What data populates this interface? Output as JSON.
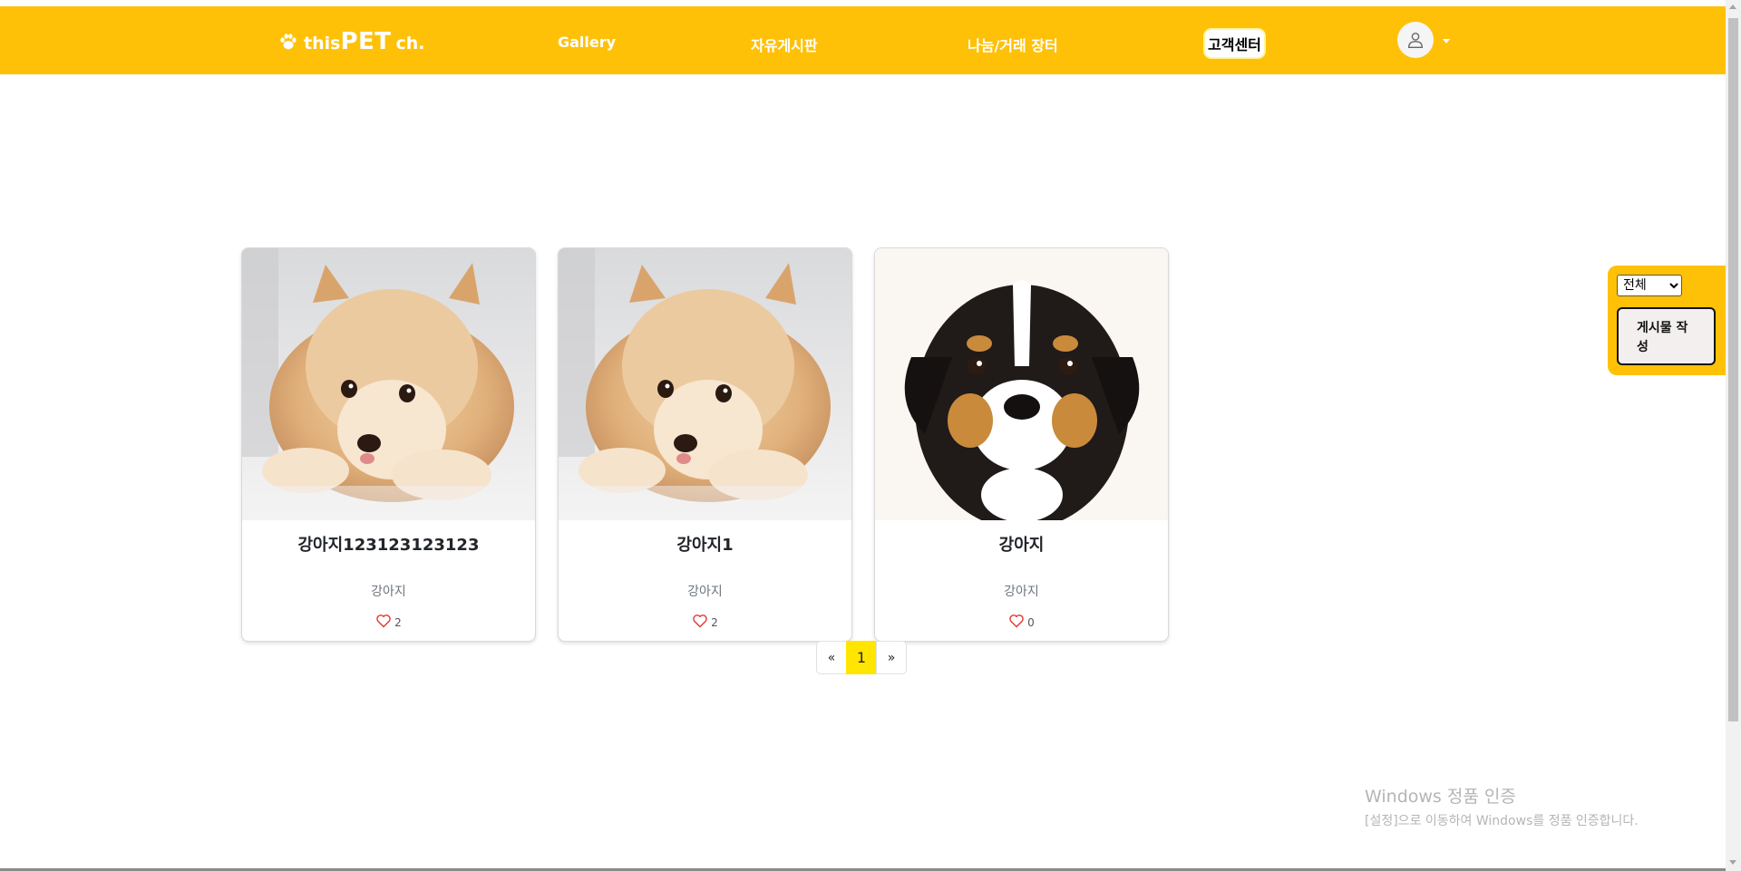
{
  "header": {
    "logo": {
      "this": "this",
      "pet": "PET",
      "ch": "ch."
    },
    "nav": [
      "Gallery",
      "자유게시판",
      "나눔/거래 장터",
      "고객센터"
    ]
  },
  "cards": [
    {
      "title": "강아지123123123123",
      "category": "강아지",
      "likes": "2",
      "image": "pomeranian-puppy"
    },
    {
      "title": "강아지1",
      "category": "강아지",
      "likes": "2",
      "image": "pomeranian-puppy"
    },
    {
      "title": "강아지",
      "category": "강아지",
      "likes": "0",
      "image": "tricolor-puppy"
    }
  ],
  "pagination": {
    "prev": "«",
    "current": "1",
    "next": "»"
  },
  "sidebar": {
    "filter_selected": "전체",
    "write_button": "게시물 작성"
  },
  "watermark": {
    "line1": "Windows 정품 인증",
    "line2": "[설정]으로 이동하여 Windows를 정품 인증합니다."
  },
  "colors": {
    "accent": "#ffc107",
    "page_active": "#ffe500",
    "heart": "#e53935"
  }
}
